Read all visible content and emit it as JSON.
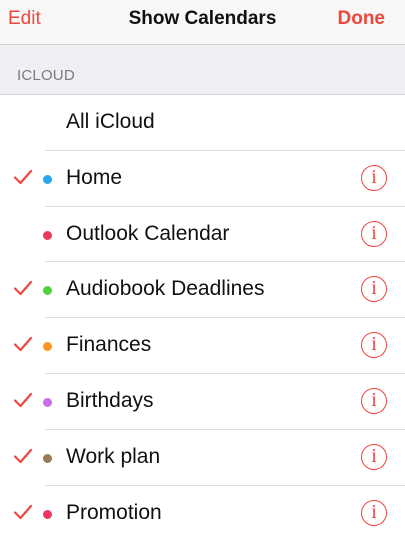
{
  "nav": {
    "edit_label": "Edit",
    "title": "Show Calendars",
    "done_label": "Done"
  },
  "section": {
    "header": "ICLOUD"
  },
  "calendars": [
    {
      "label": "All iCloud",
      "checked": false,
      "color": null,
      "info": false
    },
    {
      "label": "Home",
      "checked": true,
      "color": "#2aa5f0",
      "info": true,
      "info_glyph": "i"
    },
    {
      "label": "Outlook Calendar",
      "checked": false,
      "color": "#f0385c",
      "info": true,
      "info_glyph": "i"
    },
    {
      "label": "Audiobook Deadlines",
      "checked": true,
      "color": "#4cd438",
      "info": true,
      "info_glyph": "i"
    },
    {
      "label": "Finances",
      "checked": true,
      "color": "#ff9622",
      "info": true,
      "info_glyph": "i"
    },
    {
      "label": "Birthdays",
      "checked": true,
      "color": "#c86ee8",
      "info": true,
      "info_glyph": "i"
    },
    {
      "label": "Work plan",
      "checked": true,
      "color": "#9b7b55",
      "info": true,
      "info_glyph": "i"
    },
    {
      "label": "Promotion",
      "checked": true,
      "color": "#f0385c",
      "info": true,
      "info_glyph": "i"
    }
  ],
  "accent_color": "#f0463c"
}
